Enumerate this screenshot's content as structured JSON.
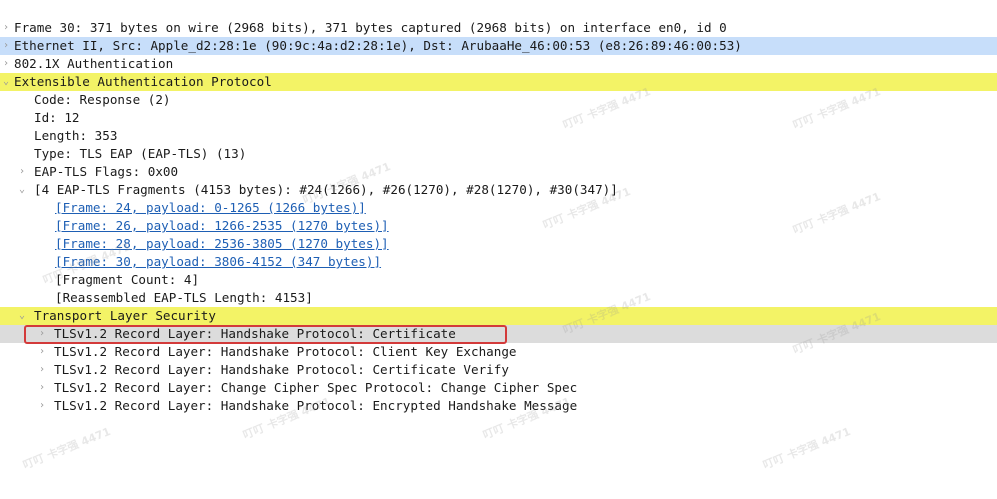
{
  "tree": {
    "frame": "Frame 30: 371 bytes on wire (2968 bits), 371 bytes captured (2968 bits) on interface en0, id 0",
    "ethernet": "Ethernet II, Src: Apple_d2:28:1e (90:9c:4a:d2:28:1e), Dst: ArubaaHe_46:00:53 (e8:26:89:46:00:53)",
    "auth": "802.1X Authentication",
    "eap": {
      "title": "Extensible Authentication Protocol",
      "code": "Code: Response (2)",
      "id": "Id: 12",
      "length": "Length: 353",
      "type": "Type: TLS EAP (EAP-TLS) (13)",
      "flags": "EAP-TLS Flags: 0x00",
      "fragments": {
        "title": "[4 EAP-TLS Fragments (4153 bytes): #24(1266), #26(1270), #28(1270), #30(347)]",
        "items": [
          "[Frame: 24, payload: 0-1265 (1266 bytes)]",
          "[Frame: 26, payload: 1266-2535 (1270 bytes)]",
          "[Frame: 28, payload: 2536-3805 (1270 bytes)]",
          "[Frame: 30, payload: 3806-4152 (347 bytes)]"
        ],
        "count": "[Fragment Count: 4]",
        "reassembled": "[Reassembled EAP-TLS Length: 4153]"
      }
    },
    "tls": {
      "title": "Transport Layer Security",
      "records": [
        "TLSv1.2 Record Layer: Handshake Protocol: Certificate",
        "TLSv1.2 Record Layer: Handshake Protocol: Client Key Exchange",
        "TLSv1.2 Record Layer: Handshake Protocol: Certificate Verify",
        "TLSv1.2 Record Layer: Change Cipher Spec Protocol: Change Cipher Spec",
        "TLSv1.2 Record Layer: Handshake Protocol: Encrypted Handshake Message"
      ]
    }
  },
  "watermark": "叮叮 卡字强 4471",
  "icons": {
    "collapsed": "chevron-right-icon",
    "expanded": "chevron-down-icon"
  },
  "colors": {
    "row_blue": "#c7defa",
    "row_yellow": "#f3f366",
    "row_selected": "#dcdcdc",
    "selection_outline": "#d33a3a",
    "link": "#1e5fb4"
  }
}
